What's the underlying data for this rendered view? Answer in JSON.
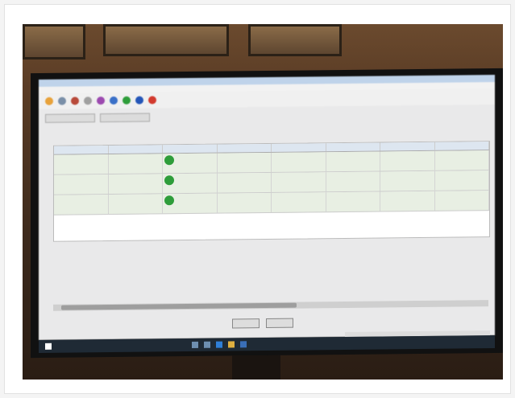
{
  "photo": {
    "subject": "monitor-displaying-signature-verification-app",
    "colors": {
      "wall": "#5a3c25",
      "screen": "#e9e9ea",
      "row_valid": "#e8efe3",
      "check": "#2e9d3a"
    }
  },
  "app": {
    "toolbar_icons": [
      "folder-icon",
      "refresh-icon",
      "pen-icon",
      "document-icon",
      "pen-icon",
      "globe-icon",
      "check-icon",
      "help-icon",
      "close-icon"
    ],
    "table_rows": 3
  }
}
